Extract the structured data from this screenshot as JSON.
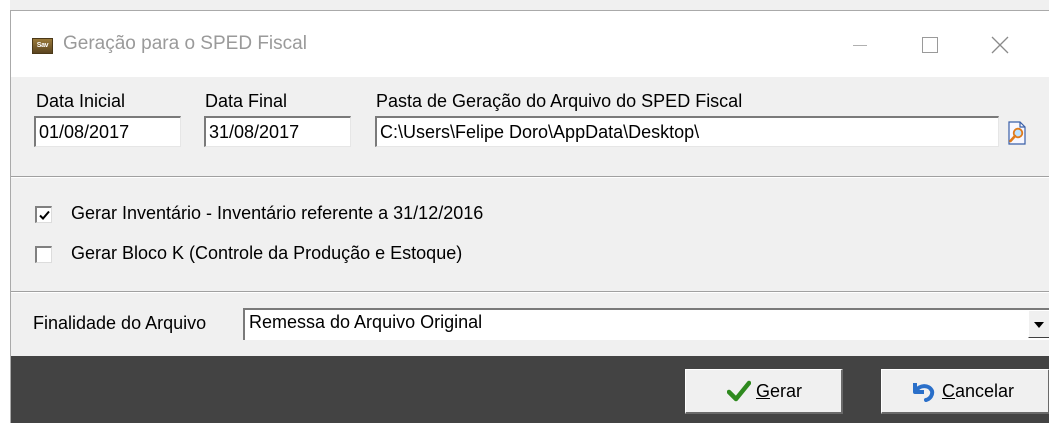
{
  "window": {
    "title": "Geração para o SPED Fiscal",
    "app_icon_text": "Sav"
  },
  "fields": {
    "data_inicial": {
      "label": "Data Inicial",
      "value": "01/08/2017"
    },
    "data_final": {
      "label": "Data Final",
      "value": "31/08/2017"
    },
    "pasta": {
      "label": "Pasta de Geração do Arquivo do SPED Fiscal",
      "value": "C:\\Users\\Felipe Doro\\AppData\\Desktop\\"
    }
  },
  "options": {
    "inventario": {
      "label": "Gerar Inventário - Inventário referente a 31/12/2016",
      "checked": true
    },
    "bloco_k": {
      "label": "Gerar Bloco K (Controle da Produção e Estoque)",
      "checked": false
    }
  },
  "finalidade": {
    "label": "Finalidade do Arquivo",
    "selected": "Remessa do Arquivo Original"
  },
  "buttons": {
    "gerar": "Gerar",
    "cancelar": "Cancelar"
  },
  "colors": {
    "bottom_panel": "#434343",
    "check_icon": "#2f8a1f",
    "cancel_icon": "#2a6fc9"
  }
}
